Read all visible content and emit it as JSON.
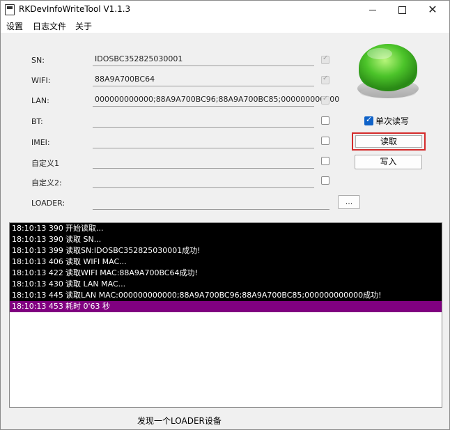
{
  "window": {
    "title": "RKDevInfoWriteTool V1.1.3",
    "minimize_icon": "minimize-icon",
    "maximize_icon": "maximize-icon",
    "close_label": "✕"
  },
  "menu": [
    "设置",
    "日志文件",
    "关于"
  ],
  "fields": {
    "sn": {
      "label": "SN:",
      "value": "IDOSBC352825030001",
      "checked": true
    },
    "wifi": {
      "label": "WIFI:",
      "value": "88A9A700BC64",
      "checked": true
    },
    "lan": {
      "label": "LAN:",
      "value": "000000000000;88A9A700BC96;88A9A700BC85;000000000000",
      "checked": true
    },
    "bt": {
      "label": "BT:",
      "value": "",
      "checked": false
    },
    "imei": {
      "label": "IMEI:",
      "value": "",
      "checked": false
    },
    "custom1": {
      "label": "自定义1",
      "value": "",
      "checked": false
    },
    "custom2": {
      "label": "自定义2:",
      "value": "",
      "checked": false
    },
    "loader": {
      "label": "LOADER:",
      "value": ""
    }
  },
  "browse_label": "...",
  "single_rw": {
    "label": "单次读写",
    "checked": true
  },
  "read_label": "读取",
  "write_label": "写入",
  "big_button_color": "#4cc42a",
  "log": [
    {
      "time": "18:10:13 390",
      "msg": "开始读取..."
    },
    {
      "time": "18:10:13 390",
      "msg": "读取 SN..."
    },
    {
      "time": "18:10:13 399",
      "msg": "读取SN:IDOSBC352825030001成功!"
    },
    {
      "time": "18:10:13 406",
      "msg": "读取 WIFI MAC..."
    },
    {
      "time": "18:10:13 422",
      "msg": "读取WIFI MAC:88A9A700BC64成功!"
    },
    {
      "time": "18:10:13 430",
      "msg": "读取 LAN MAC..."
    },
    {
      "time": "18:10:13 445",
      "msg": "读取LAN MAC:000000000000;88A9A700BC96;88A9A700BC85;000000000000成功!"
    },
    {
      "time": "18:10:13 453",
      "msg": "耗时 0'63 秒"
    }
  ],
  "status": "发现一个LOADER设备"
}
